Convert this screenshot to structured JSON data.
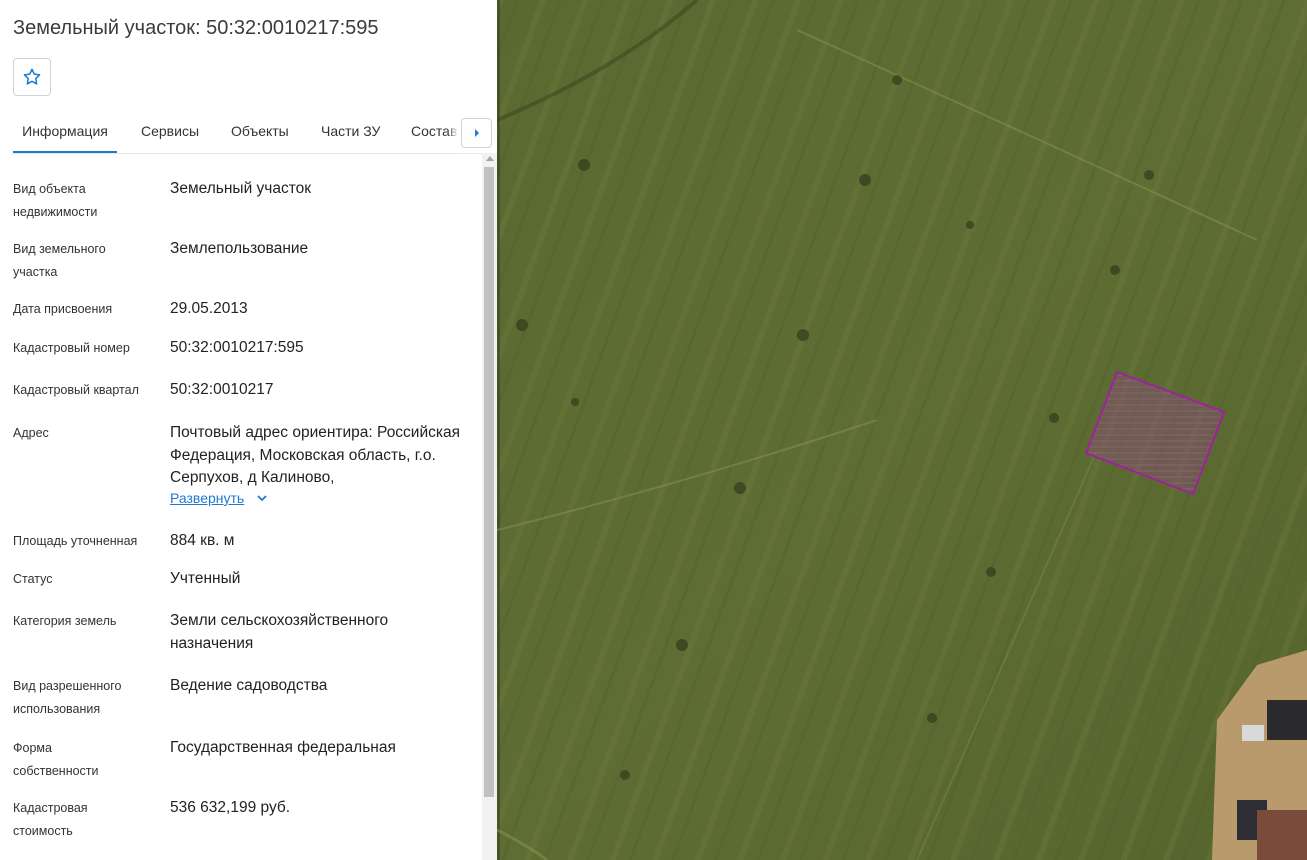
{
  "title": "Земельный участок: 50:32:0010217:595",
  "favorite": {
    "icon": "star-outline-icon"
  },
  "tabs": [
    {
      "label": "Информация",
      "active": true
    },
    {
      "label": "Сервисы"
    },
    {
      "label": "Объекты"
    },
    {
      "label": "Части ЗУ"
    },
    {
      "label": "Состав"
    }
  ],
  "tabs_next_icon": "caret-right-icon",
  "fields": [
    {
      "label": "Вид объекта недвижимости",
      "value": "Земельный участок"
    },
    {
      "label": "Вид земельного участка",
      "value": "Землепользование"
    },
    {
      "label": "Дата присвоения",
      "value": "29.05.2013"
    },
    {
      "label": "Кадастровый номер",
      "value": "50:32:0010217:595"
    },
    {
      "label": "Кадастровый квартал",
      "value": "50:32:0010217"
    },
    {
      "label": "Адрес",
      "value": "Почтовый адрес ориентира: Российская Федерация, Московская область, г.о. Серпухов, д Калиново,",
      "expand_label": "Развернуть"
    },
    {
      "label": "Площадь уточненная",
      "value": "884 кв. м"
    },
    {
      "label": "Статус",
      "value": "Учтенный"
    },
    {
      "label": "Категория земель",
      "value": "Земли сельскохозяйственного назначения"
    },
    {
      "label": "Вид разрешенного использования",
      "value": "Ведение садоводства"
    },
    {
      "label": "Форма собственности",
      "value": "Государственная федеральная"
    },
    {
      "label": "Кадастровая стоимость",
      "value": "536 632,199 руб."
    }
  ],
  "map": {
    "type": "satellite",
    "parcel_highlight_color": "#a020a0",
    "ground_color": "#5b6a2e"
  }
}
